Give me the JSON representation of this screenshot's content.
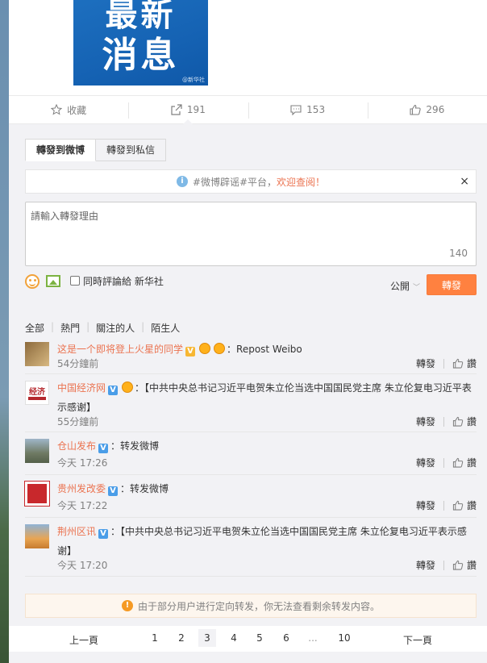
{
  "image": {
    "line1": "最新",
    "line2": "消息",
    "watermark": "@新华社"
  },
  "actions": {
    "favorite": "收藏",
    "repost_count": "191",
    "comment_count": "153",
    "like_count": "296"
  },
  "tabs": {
    "to_weibo": "轉發到微博",
    "to_message": "轉發到私信"
  },
  "tip": {
    "prefix": "#微博辟谣#平台，",
    "highlight": "欢迎查阅！",
    "close": "×"
  },
  "composer": {
    "placeholder": "請輸入轉發理由",
    "remaining": "140",
    "also_comment": "同時評論給 新华社",
    "visibility": "公開",
    "submit": "轉發"
  },
  "filters": [
    "全部",
    "熱門",
    "關注的人",
    "陌生人"
  ],
  "reposts": [
    {
      "user": "这是一个即将登上火星的同学",
      "badge": "V",
      "text": "：Repost Weibo",
      "text2": "",
      "time": "54分鐘前"
    },
    {
      "user": "中国经济网",
      "badge": "V",
      "text": "：【中共中央总书记习近平电贺朱立伦当选中国国民党主席 朱立伦复电习近平表",
      "text2": "示感谢】",
      "time": "55分鐘前"
    },
    {
      "user": "仓山发布",
      "badge": "V",
      "text": "：转发微博",
      "text2": "",
      "time": "今天 17:26"
    },
    {
      "user": "贵州发改委",
      "badge": "V",
      "text": "：转发微博",
      "text2": "",
      "time": "今天 17:22"
    },
    {
      "user": "荆州区讯",
      "badge": "V",
      "text": "：【中共中央总书记习近平电贺朱立伦当选中国国民党主席 朱立伦复电习近平表示感",
      "text2": "谢】",
      "time": "今天 17:20"
    }
  ],
  "row_ops": {
    "repost": "轉發",
    "like": "讚"
  },
  "notice": "由于部分用户进行定向转发，你无法查看剩余转发内容。",
  "pager": {
    "prev": "上一頁",
    "next": "下一頁",
    "pages": [
      "1",
      "2",
      "3",
      "4",
      "5",
      "6",
      "...",
      "10"
    ],
    "current": "3"
  },
  "colors": {
    "accent": "#eb7350",
    "button": "#ff8140",
    "vip_yellow": "#f7b733",
    "verified_blue": "#4a9de8"
  }
}
